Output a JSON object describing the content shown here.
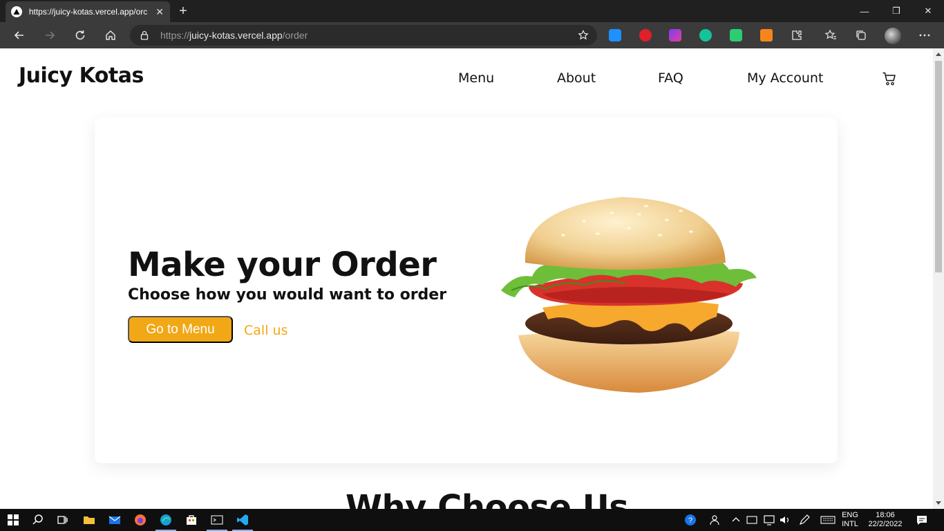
{
  "browser": {
    "tab_title": "https://juicy-kotas.vercel.app/orc",
    "url_scheme": "https://",
    "url_host": "juicy-kotas.vercel.app",
    "url_path": "/order"
  },
  "site": {
    "brand": "Juicy Kotas",
    "nav": [
      "Menu",
      "About",
      "FAQ",
      "My Account"
    ]
  },
  "hero": {
    "title": "Make your Order",
    "subtitle": "Choose how you would want to order",
    "primary_button": "Go to Menu",
    "secondary_link": "Call us"
  },
  "section": {
    "title": "Why Choose Us"
  },
  "taskbar": {
    "language_top": "ENG",
    "language_bottom": "INTL",
    "time": "18:06",
    "date": "22/2/2022"
  },
  "colors": {
    "accent": "#f2a716",
    "chrome_dark": "#202020",
    "toolbar": "#3b3b3b"
  }
}
